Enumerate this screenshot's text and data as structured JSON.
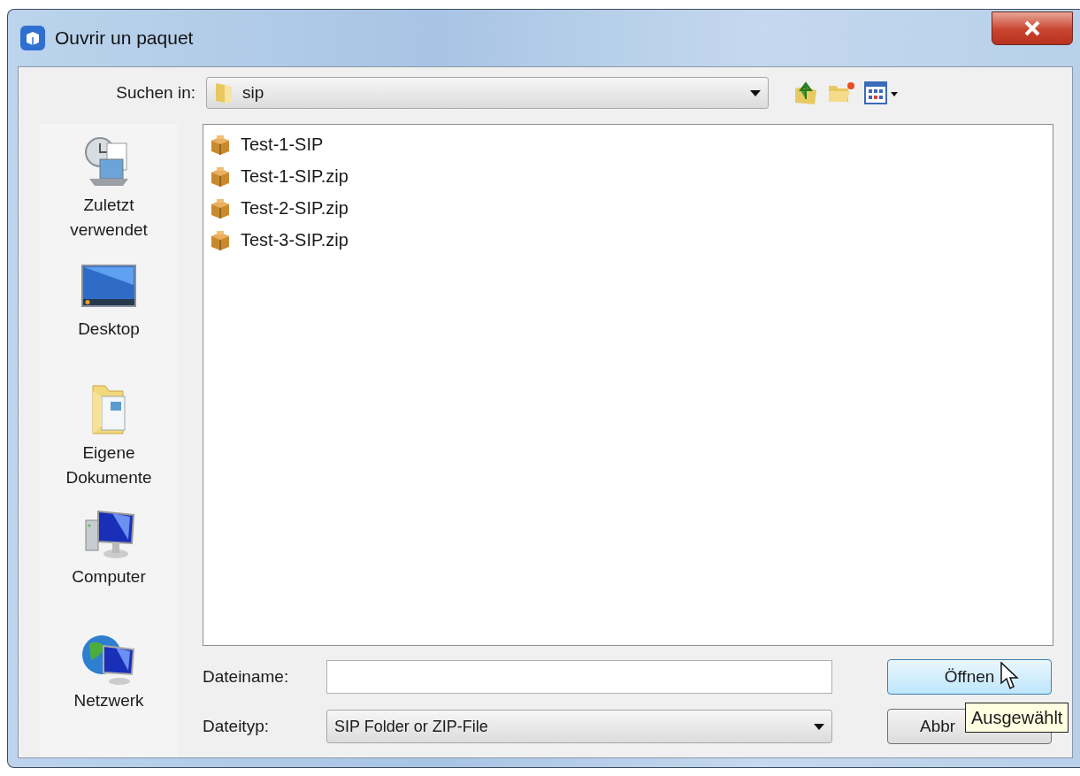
{
  "window": {
    "title": "Ouvrir un paquet"
  },
  "look_in": {
    "label": "Suchen in:",
    "value": "sip"
  },
  "places": [
    {
      "kind": "recent",
      "label": "Zuletzt verwendet"
    },
    {
      "kind": "desktop",
      "label": "Desktop"
    },
    {
      "kind": "documents",
      "label": "Eigene Dokumente"
    },
    {
      "kind": "computer",
      "label": "Computer"
    },
    {
      "kind": "network",
      "label": "Netzwerk"
    }
  ],
  "files": [
    {
      "name": "Test-1-SIP"
    },
    {
      "name": "Test-1-SIP.zip"
    },
    {
      "name": "Test-2-SIP.zip"
    },
    {
      "name": "Test-3-SIP.zip"
    }
  ],
  "file_name": {
    "label": "Dateiname:"
  },
  "file_type": {
    "label": "Dateityp:",
    "value": "SIP Folder or ZIP-File"
  },
  "buttons": [
    {
      "label": "Öffnen",
      "hovered": true
    },
    {
      "label": "Abbr",
      "hovered": false
    }
  ],
  "tooltip": "Ausgewählt"
}
